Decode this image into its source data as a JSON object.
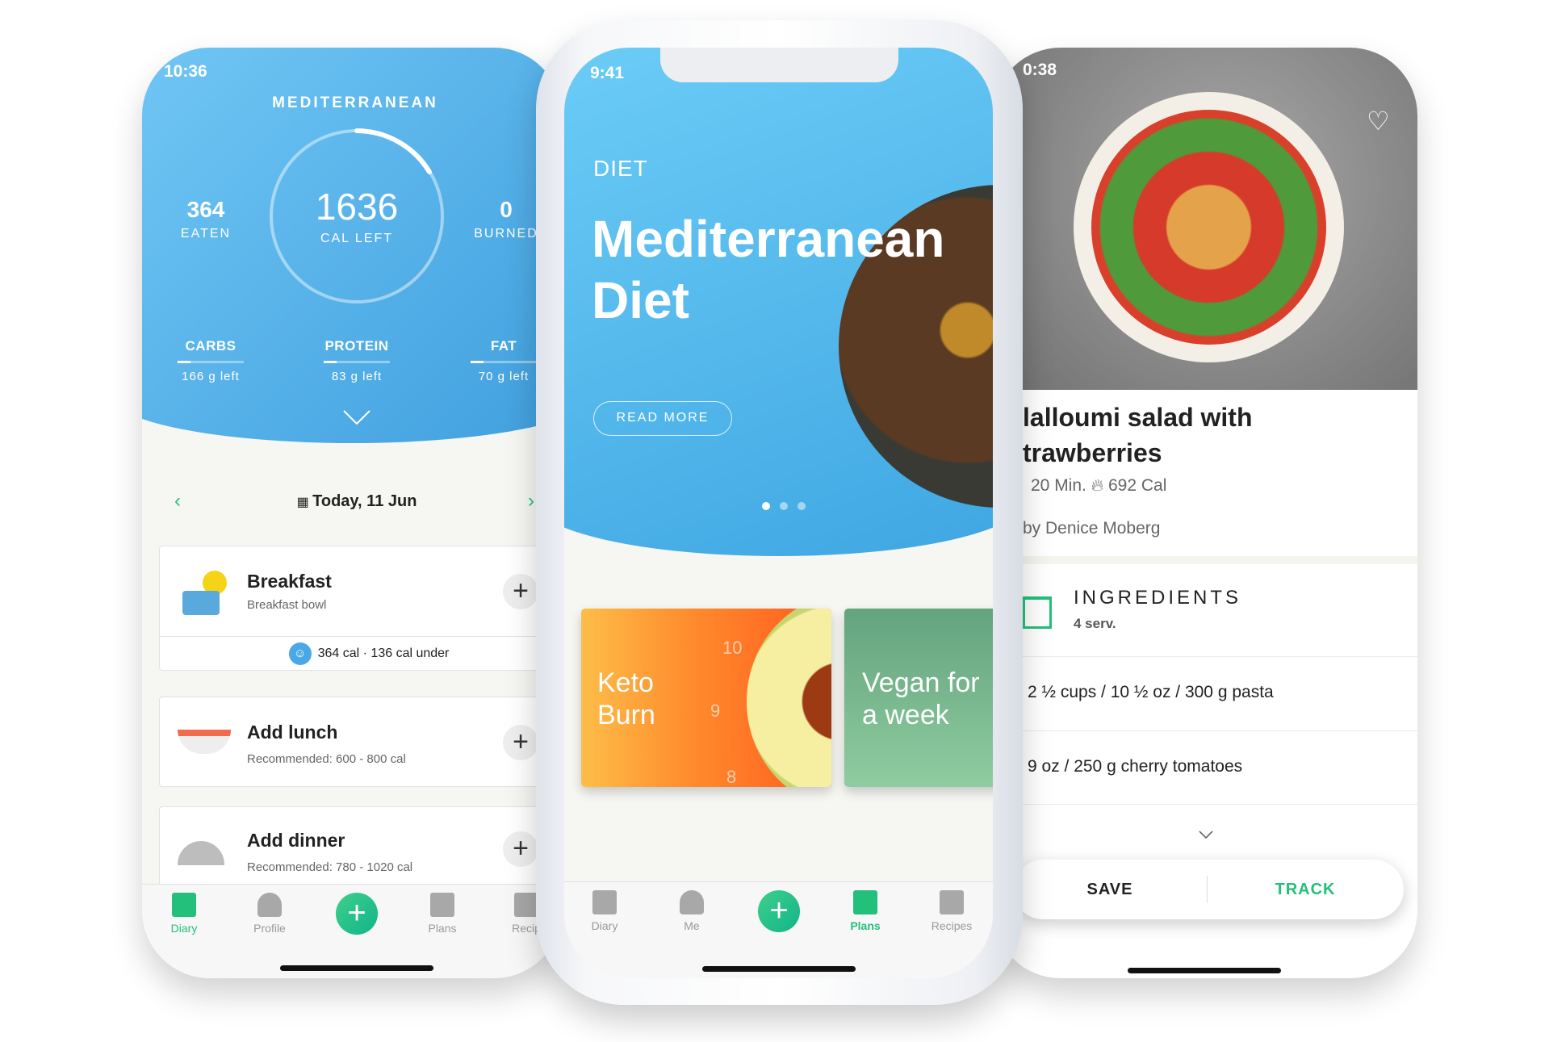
{
  "colors": {
    "accent_green": "#22c07a",
    "header_blue": "#4aa8e6"
  },
  "left": {
    "status_time": "10:36",
    "plan_title": "MEDITERRANEAN",
    "eaten": {
      "value": "364",
      "label": "EATEN"
    },
    "cal_left": {
      "value": "1636",
      "label": "CAL LEFT",
      "progress": 0.18
    },
    "burned": {
      "value": "0",
      "label": "BURNED"
    },
    "macros": [
      {
        "name": "CARBS",
        "left": "166 g left",
        "progress": 0.2
      },
      {
        "name": "PROTEIN",
        "left": "83 g left",
        "progress": 0.2
      },
      {
        "name": "FAT",
        "left": "70 g left",
        "progress": 0.2
      }
    ],
    "date": "Today, 11 Jun",
    "meals": [
      {
        "title": "Breakfast",
        "subtitle": "Breakfast bowl",
        "summary": "364 cal · 136 cal under",
        "icon": "toaster-sun-icon"
      },
      {
        "title": "Add lunch",
        "subtitle": "Recommended: 600 - 800  cal",
        "icon": "salmon-salad-icon"
      },
      {
        "title": "Add dinner",
        "subtitle": "Recommended: 780 - 1020  cal",
        "icon": "cloche-candle-icon"
      }
    ],
    "tabs": [
      {
        "label": "Diary",
        "active": true
      },
      {
        "label": "Profile"
      },
      {
        "label": "Plans"
      },
      {
        "label": "Recip"
      }
    ]
  },
  "middle": {
    "status_time": "9:41",
    "category": "DIET",
    "title_line1": "Mediterranean",
    "title_line2": "Diet",
    "read_more": "READ MORE",
    "carousel": {
      "pages": 3,
      "active": 0
    },
    "plans": [
      {
        "line1": "Keto",
        "line2": "Burn",
        "dial": [
          "10",
          "9",
          "8"
        ]
      },
      {
        "line1": "Vegan for",
        "line2": "a week"
      }
    ],
    "tabs": [
      {
        "label": "Diary"
      },
      {
        "label": "Me"
      },
      {
        "label": "Plans",
        "active": true
      },
      {
        "label": "Recipes"
      }
    ]
  },
  "right": {
    "status_time": "0:38",
    "title_line1": "lalloumi salad with",
    "title_line2": "trawberries",
    "time": "20 Min.",
    "calories": "692 Cal",
    "author": "by Denice Moberg",
    "ingredients_title": "INGREDIENTS",
    "servings": "4 serv.",
    "ingredients": [
      "2 ½ cups / 10 ½ oz / 300 g pasta",
      "9 oz / 250 g cherry tomatoes"
    ],
    "save": "SAVE",
    "track": "TRACK"
  }
}
